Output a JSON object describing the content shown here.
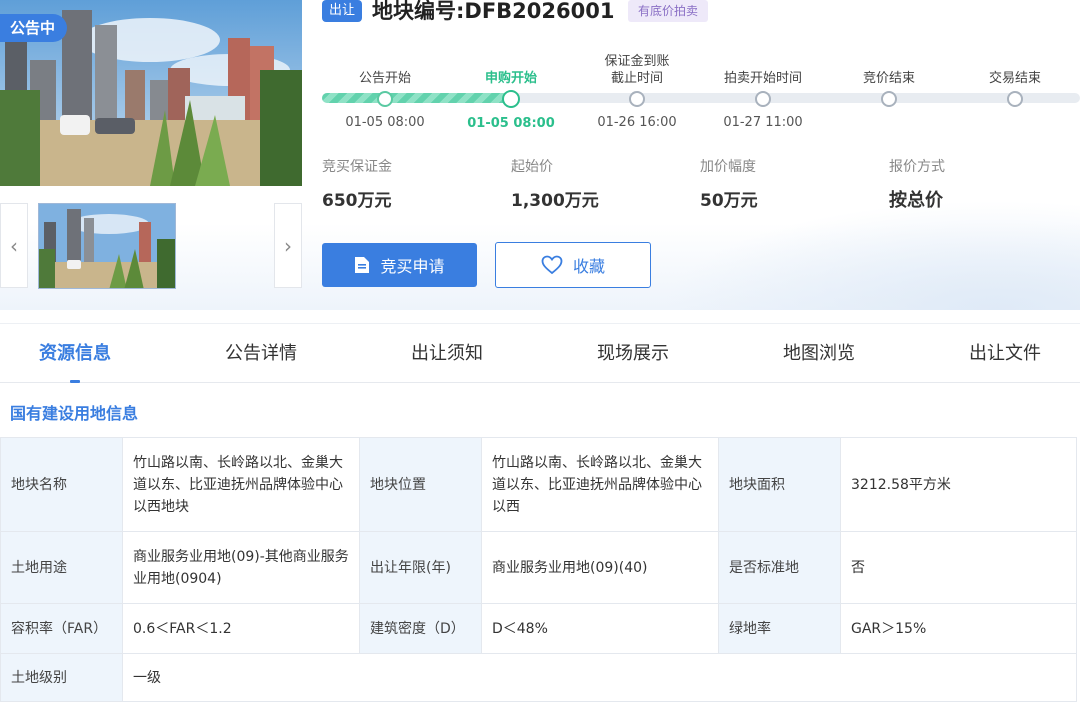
{
  "gallery": {
    "status_tag": "公告中",
    "prev_arrow": "‹",
    "next_arrow": "›"
  },
  "header": {
    "type_tag": "出让",
    "title": "地块编号:DFB2026001",
    "reserve_tag": "有底价拍卖"
  },
  "timeline": {
    "progress": 0.25,
    "steps": [
      {
        "label": "公告开始",
        "time": "01-05 08:00",
        "state": "done"
      },
      {
        "label": "申购开始",
        "time": "01-05 08:00",
        "state": "active"
      },
      {
        "label": "保证金到账\n截止时间",
        "time": "01-26 16:00",
        "state": "pending"
      },
      {
        "label": "拍卖开始时间",
        "time": "01-27 11:00",
        "state": "pending"
      },
      {
        "label": "竞价结束",
        "time": "",
        "state": "pending"
      },
      {
        "label": "交易结束",
        "time": "",
        "state": "pending"
      }
    ]
  },
  "price_info": [
    {
      "label": "竞买保证金",
      "value": "650万元"
    },
    {
      "label": "起始价",
      "value": "1,300万元"
    },
    {
      "label": "加价幅度",
      "value": "50万元"
    },
    {
      "label": "报价方式",
      "value": "按总价"
    }
  ],
  "actions": {
    "apply_label": "竞买申请",
    "apply_icon": "document-icon",
    "favorite_label": "收藏",
    "favorite_icon": "heart-icon"
  },
  "tabs": [
    {
      "label": "资源信息",
      "active": true
    },
    {
      "label": "公告详情",
      "active": false
    },
    {
      "label": "出让须知",
      "active": false
    },
    {
      "label": "现场展示",
      "active": false
    },
    {
      "label": "地图浏览",
      "active": false
    },
    {
      "label": "出让文件",
      "active": false
    }
  ],
  "section": {
    "title": "国有建设用地信息",
    "rows": [
      [
        {
          "key": "地块名称",
          "value": "竹山路以南、长岭路以北、金巢大道以东、比亚迪抚州品牌体验中心以西地块"
        },
        {
          "key": "地块位置",
          "value": "竹山路以南、长岭路以北、金巢大道以东、比亚迪抚州品牌体验中心以西"
        },
        {
          "key": "地块面积",
          "value": "3212.58平方米"
        }
      ],
      [
        {
          "key": "土地用途",
          "value": "商业服务业用地(09)-其他商业服务业用地(0904)"
        },
        {
          "key": "出让年限(年)",
          "value": "商业服务业用地(09)(40)"
        },
        {
          "key": "是否标准地",
          "value": "否"
        }
      ],
      [
        {
          "key": "容积率（FAR）",
          "value": "0.6＜FAR＜1.2"
        },
        {
          "key": "建筑密度（D）",
          "value": "D＜48%"
        },
        {
          "key": "绿地率",
          "value": "GAR＞15%"
        }
      ],
      [
        {
          "key": "土地级别",
          "value": "一级"
        }
      ]
    ]
  },
  "colors": {
    "accent": "#3a7ee0",
    "progress_green": "#2bbf8c",
    "key_cell_bg": "#eef5fc",
    "reserve_tag_bg": "#eee9f9"
  }
}
